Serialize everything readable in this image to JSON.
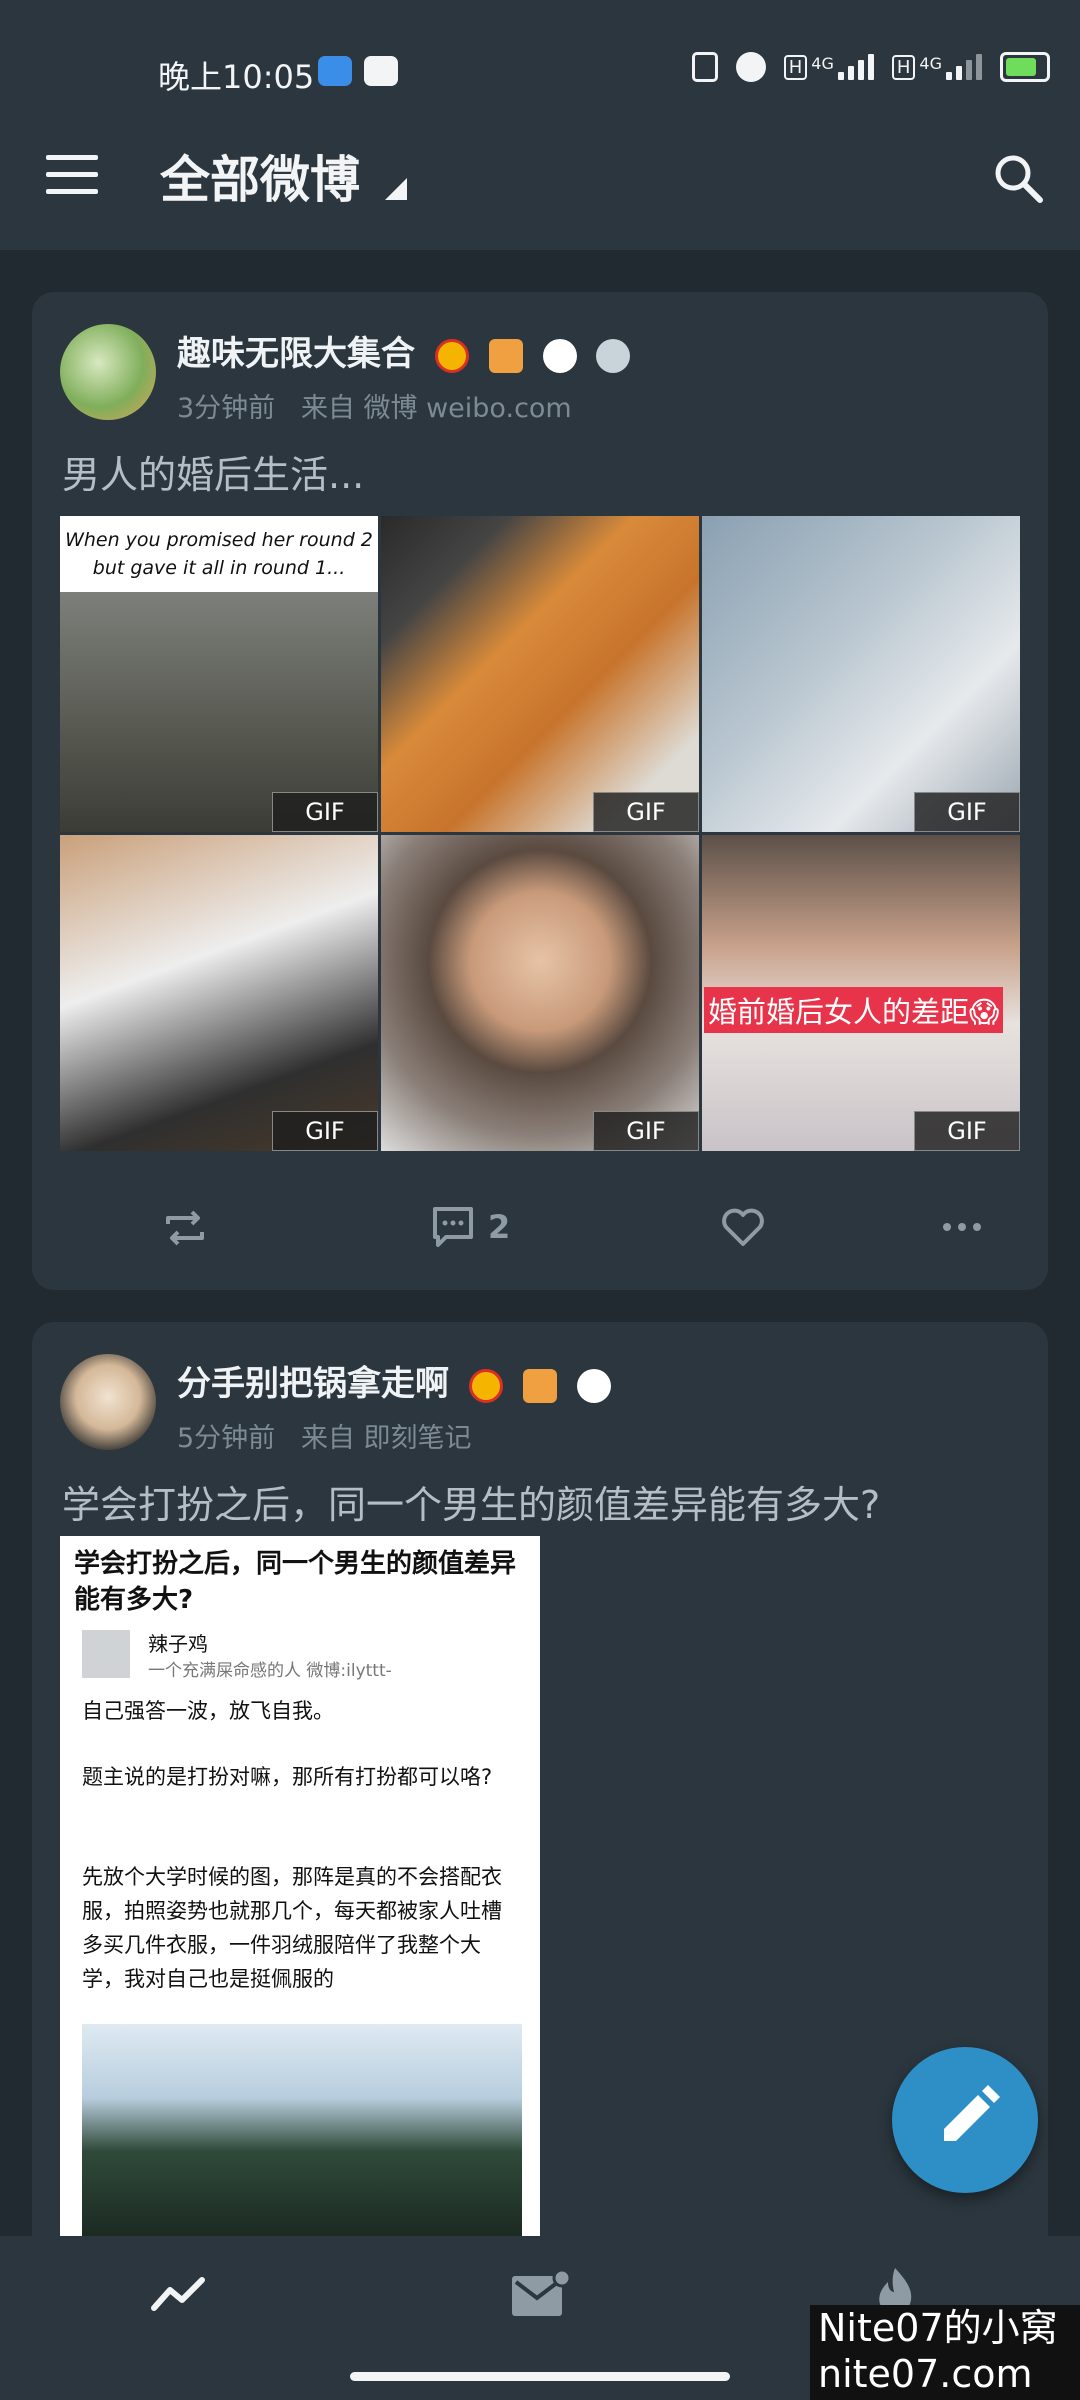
{
  "status": {
    "time": "晚上10:05",
    "net_label_1": "4G",
    "net_label_2": "4G"
  },
  "header": {
    "title": "全部微博"
  },
  "posts": [
    {
      "author": "趣味无限大集合",
      "time": "3分钟前",
      "source": "来自 微博 weibo.com",
      "text": "男人的婚后生活...",
      "image_caption_1": "When you promised her round 2",
      "image_caption_2": "but gave it all in round 1...",
      "image_overlay_text": "婚前婚后女人的差距😱",
      "gif_label": "GIF",
      "comment_count": "2"
    },
    {
      "author": "分手别把锅拿走啊",
      "time": "5分钟前",
      "source": "来自 即刻笔记",
      "text": "学会打扮之后，同一个男生的颜值差异能有多大?",
      "embed": {
        "title": "学会打扮之后，同一个男生的颜值差异能有多大?",
        "user": "辣子鸡",
        "user_desc": "一个充满屎命感的人 微博:ilyttt-",
        "p1": "自己强答一波，放飞自我。",
        "p2": "题主说的是打扮对嘛，那所有打扮都可以咯?",
        "p3": "先放个大学时候的图，那阵是真的不会搭配衣服，拍照姿势也就那几个，每天都被家人吐槽多买几件衣服，一件羽绒服陪伴了我整个大学，我对自己也是挺佩服的"
      }
    }
  ],
  "watermark": {
    "line1": "Nite07的小窝",
    "line2": "nite07.com"
  },
  "colors": {
    "background": "#212a31",
    "card": "#2b363e",
    "fab": "#2e8fc7",
    "muted": "#7d8a94"
  }
}
